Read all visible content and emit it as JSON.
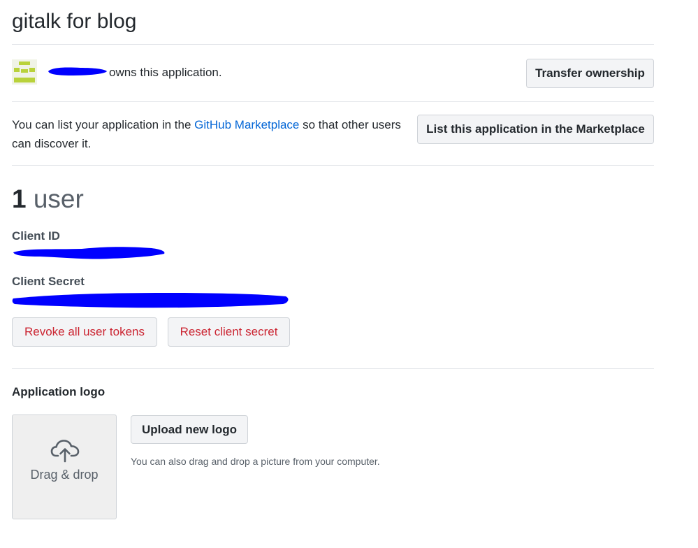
{
  "app": {
    "title": "gitalk for blog"
  },
  "owner": {
    "suffix_text": "owns this application.",
    "transfer_label": "Transfer ownership"
  },
  "marketplace": {
    "text_before": "You can list your application in the ",
    "link_text": "GitHub Marketplace",
    "text_after": " so that other users can discover it.",
    "button_label": "List this application in the Marketplace"
  },
  "users": {
    "count": "1",
    "unit": " user"
  },
  "credentials": {
    "client_id_label": "Client ID",
    "client_secret_label": "Client Secret",
    "revoke_label": "Revoke all user tokens",
    "reset_label": "Reset client secret"
  },
  "logo": {
    "section_title": "Application logo",
    "drag_text": "Drag & drop",
    "upload_label": "Upload new logo",
    "hint": "You can also drag and drop a picture from your computer."
  },
  "colors": {
    "link": "#0366d6",
    "danger": "#cb2431",
    "redaction": "#0000ff",
    "avatar_accent": "#b9d23a"
  },
  "icons": {
    "upload": "cloud-upload-icon",
    "avatar": "identicon-avatar"
  }
}
